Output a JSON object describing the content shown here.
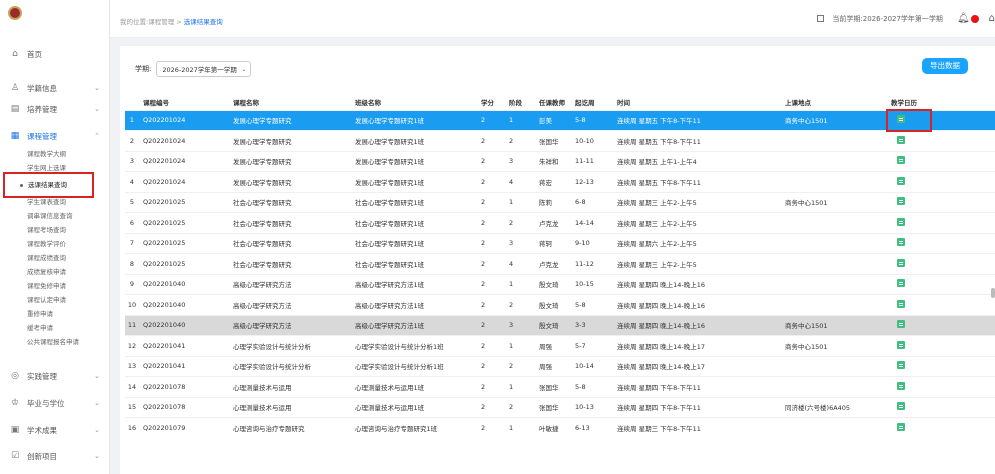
{
  "sidebar": {
    "items": [
      {
        "label": "首页",
        "icon": "home-icon"
      },
      {
        "label": "学籍信息",
        "icon": "user-icon"
      },
      {
        "label": "培养管理",
        "icon": "book-icon"
      },
      {
        "label": "课程管理",
        "icon": "course-icon"
      }
    ],
    "sub_items": [
      "课程教学大纲",
      "学生网上选课",
      "选课结果查询",
      "学生课表查询",
      "调串课信息查询",
      "课程考场查询",
      "课程教学评价",
      "课程成绩查询",
      "成绩复核申请",
      "课程免修申请",
      "课程认定申请",
      "重修申请",
      "缓考申请",
      "公共课程报名申请"
    ],
    "bottom_items": [
      {
        "label": "实践管理",
        "icon": "practice-icon"
      },
      {
        "label": "毕业与学位",
        "icon": "graduation-icon"
      },
      {
        "label": "学术成果",
        "icon": "achievement-icon"
      },
      {
        "label": "创新项目",
        "icon": "innovation-icon"
      }
    ]
  },
  "header": {
    "breadcrumb_prefix": "我的位置:课程管理 > ",
    "breadcrumb_current": "选课结果查询",
    "semester_text": "当前学期:2026-2027学年第一学期"
  },
  "filter": {
    "label": "学期:",
    "value": "2026-2027学年第一学期"
  },
  "export_label": "导出数据",
  "table": {
    "headers": [
      "课程编号",
      "课程名称",
      "班级名称",
      "学分",
      "阶段",
      "任课教师",
      "起讫周",
      "时间",
      "上课地点",
      "教学日历"
    ],
    "rows": [
      [
        "1",
        "Q202201024",
        "发展心理学专题研究",
        "发展心理学专题研究1班",
        "2",
        "1",
        "彭美",
        "5-8",
        "连续周 星期五 下午8-下午11",
        "商务中心1501"
      ],
      [
        "2",
        "Q202201024",
        "发展心理学专题研究",
        "发展心理学专题研究1班",
        "2",
        "2",
        "张国华",
        "10-10",
        "连续周 星期五 下午8-下午11",
        ""
      ],
      [
        "3",
        "Q202201024",
        "发展心理学专题研究",
        "发展心理学专题研究1班",
        "2",
        "3",
        "朱祥和",
        "11-11",
        "连续周 星期五 上午1-上午4",
        ""
      ],
      [
        "4",
        "Q202201024",
        "发展心理学专题研究",
        "发展心理学专题研究1班",
        "2",
        "4",
        "蒋宏",
        "12-13",
        "连续周 星期五 下午8-下午11",
        ""
      ],
      [
        "5",
        "Q202201025",
        "社会心理学专题研究",
        "社会心理学专题研究1班",
        "2",
        "1",
        "陈莉",
        "6-8",
        "连续周 星期三 上午2-上午5",
        "商务中心1501"
      ],
      [
        "6",
        "Q202201025",
        "社会心理学专题研究",
        "社会心理学专题研究1班",
        "2",
        "2",
        "卢克龙",
        "14-14",
        "连续周 星期三 上午2-上午5",
        ""
      ],
      [
        "7",
        "Q202201025",
        "社会心理学专题研究",
        "社会心理学专题研究1班",
        "2",
        "3",
        "蒋轲",
        "9-10",
        "连续周 星期六 上午2-上午5",
        ""
      ],
      [
        "8",
        "Q202201025",
        "社会心理学专题研究",
        "社会心理学专题研究1班",
        "2",
        "4",
        "卢克龙",
        "11-12",
        "连续周 星期三 上午2-上午5",
        ""
      ],
      [
        "9",
        "Q202201040",
        "高级心理学研究方法",
        "高级心理学研究方法1班",
        "2",
        "1",
        "殷文琦",
        "10-15",
        "连续周 星期四 晚上14-晚上16",
        ""
      ],
      [
        "10",
        "Q202201040",
        "高级心理学研究方法",
        "高级心理学研究方法1班",
        "2",
        "2",
        "殷文琦",
        "5-8",
        "连续周 星期四 晚上14-晚上16",
        ""
      ],
      [
        "11",
        "Q202201040",
        "高级心理学研究方法",
        "高级心理学研究方法1班",
        "2",
        "3",
        "殷文琦",
        "3-3",
        "连续周 星期四 晚上14-晚上16",
        "商务中心1501"
      ],
      [
        "12",
        "Q202201041",
        "心理学实验设计与统计分析",
        "心理学实验设计与统计分析1班",
        "2",
        "1",
        "周强",
        "5-7",
        "连续周 星期四 晚上14-晚上17",
        "商务中心1501"
      ],
      [
        "13",
        "Q202201041",
        "心理学实验设计与统计分析",
        "心理学实验设计与统计分析1班",
        "2",
        "2",
        "周强",
        "10-14",
        "连续周 星期四 晚上14-晚上17",
        ""
      ],
      [
        "14",
        "Q202201078",
        "心理测量技术与运用",
        "心理测量技术与运用1班",
        "2",
        "1",
        "张国华",
        "5-8",
        "连续周 星期四 下午8-下午11",
        ""
      ],
      [
        "15",
        "Q202201078",
        "心理测量技术与运用",
        "心理测量技术与运用1班",
        "2",
        "2",
        "张国华",
        "10-13",
        "连续周 星期四 下午8-下午11",
        "同济楼(六号楼)6A405"
      ],
      [
        "16",
        "Q202201079",
        "心理咨询与治疗专题研究",
        "心理咨询与治疗专题研究1班",
        "2",
        "1",
        "叶敏捷",
        "6-13",
        "连续周 星期三 下午8-下午11",
        ""
      ]
    ]
  },
  "colors": {
    "accent": "#1a9cf0",
    "highlight_box": "#d92323",
    "calendar_icon": "#3fbf7f"
  }
}
